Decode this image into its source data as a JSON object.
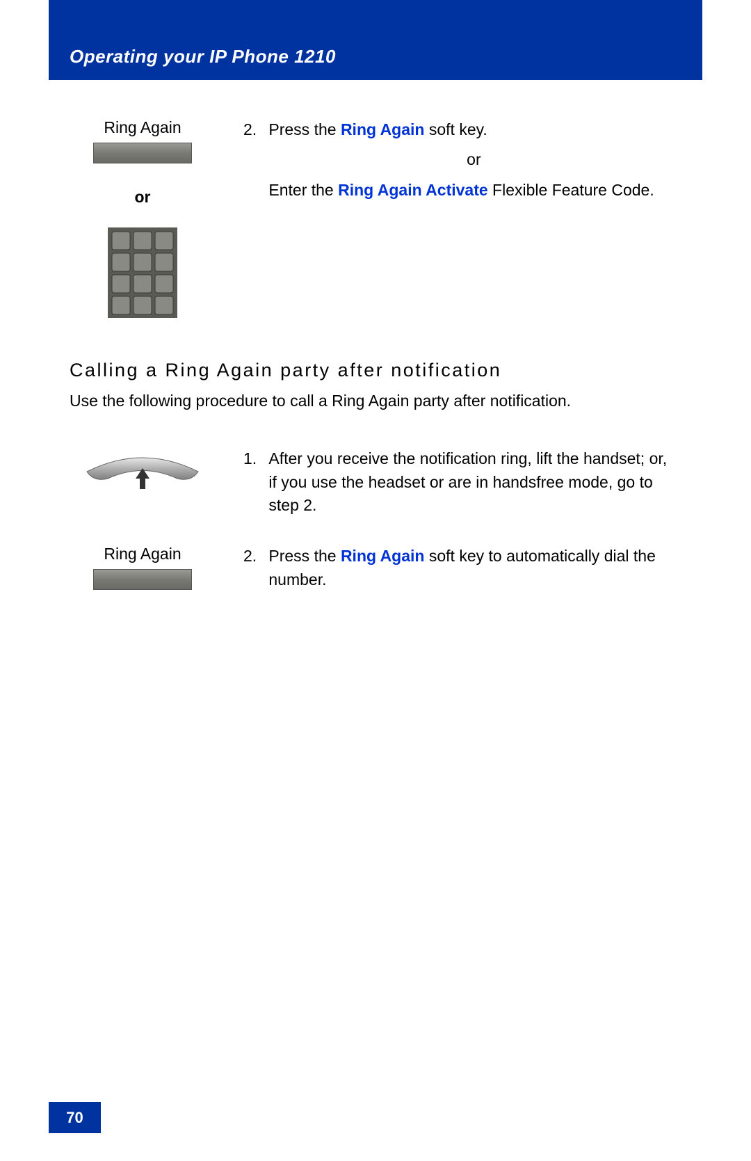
{
  "header": {
    "title": "Operating your IP Phone 1210"
  },
  "step1": {
    "leftLabel": "Ring Again",
    "orLabel": "or",
    "num": "2.",
    "textA": "Press the ",
    "bold1": "Ring Again",
    "textB": " soft key.",
    "orCenter": "or",
    "textC": "Enter the ",
    "bold2": "Ring Again Activate",
    "textD": " Flexible Feature Code."
  },
  "section": {
    "heading": "Calling a Ring Again party after notification",
    "intro": "Use the following procedure to call a Ring Again party after notification."
  },
  "step2": {
    "num": "1.",
    "text": "After you receive the notification ring, lift the handset; or, if you use the headset or are in handsfree mode, go to step 2."
  },
  "step3": {
    "leftLabel": "Ring Again",
    "num": "2.",
    "textA": "Press the ",
    "bold1": "Ring Again",
    "textB": " soft key to automatically dial the number."
  },
  "pageNumber": "70"
}
